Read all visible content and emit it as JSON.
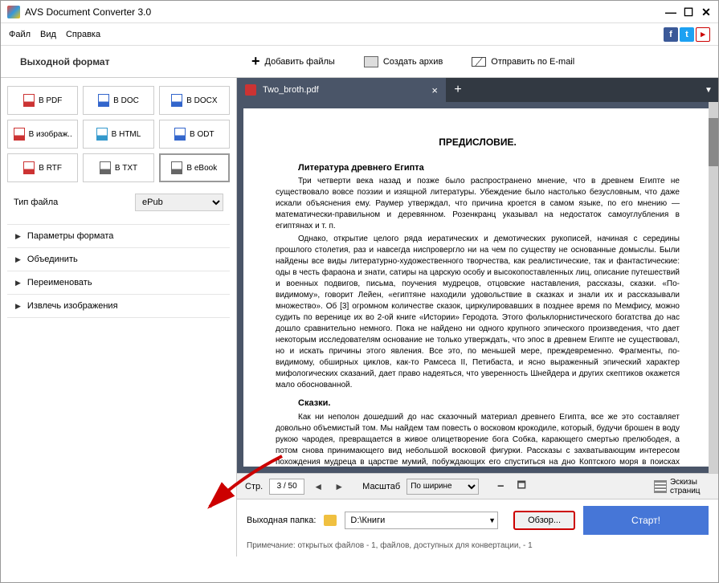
{
  "window": {
    "title": "AVS Document Converter 3.0"
  },
  "menu": {
    "file": "Файл",
    "view": "Вид",
    "help": "Справка"
  },
  "sidebar": {
    "header": "Выходной формат",
    "formats": [
      "В PDF",
      "В DOC",
      "В DOCX",
      "В изображ..",
      "В HTML",
      "В ODT",
      "В RTF",
      "В TXT",
      "В eBook"
    ],
    "filetype_label": "Тип файла",
    "filetype_value": "ePub",
    "accordion": [
      "Параметры формата",
      "Объединить",
      "Переименовать",
      "Извлечь изображения"
    ]
  },
  "toolbar": {
    "add": "Добавить файлы",
    "archive": "Создать архив",
    "email": "Отправить по E-mail"
  },
  "tab": {
    "name": "Two_broth.pdf"
  },
  "document": {
    "heading": "ПРЕДИСЛОВИЕ.",
    "sub1": "Литература древнего Египта",
    "p1": "Три четверти века назад и позже было распространено мнение, что в древнем Египте не существовало вовсе поэзии и изящной литературы. Убеждение было настолько безусловным, что даже искали объяснения ему. Раумер утверждал, что причина кроется в самом языке, по его мнению — математически-правильном и деревянном. Розенкранц указывал на недостаток самоуглубления в египтянах и т. п.",
    "p2": "Однако, открытие целого ряда иератических и демотических рукописей, начиная с середины прошлого столетия, раз и навсегда ниспровергло ни на чем по существу не основанные домыслы. Были найдены все виды литературно-художественного творчества, как реалистические, так и фантастические: оды в честь фараона и знати, сатиры на царскую особу и высокопоставленных лиц, описание путешествий и военных подвигов, письма, поучения мудрецов, отцовские наставления, рассказы, сказки. «По-видимому», говорит Лейен, «египтяне находили удовольствие в сказках и знали их и рассказывали множество». Об [3] огромном количестве сказок, циркулировавших в позднее время по Мемфису, можно судить по веренице их во 2-ой книге «Истории» Геродота. Этого фольклорнистического богатства до нас дошло сравнительно немного. Пока не найдено ни одного крупного эпического произведения, что дает некоторым исследователям основание не только утверждать, что эпос в древнем Египте не существовал, но и искать причины этого явления. Все это, по меньшей мере, преждевременно. Фрагменты, по-видимому, обширных циклов, как-то Рамсеса II, Петибаста, и ясно выраженный эпический характер мифологических сказаний, дает право надеяться, что уверенность Шнейдера и других скептиков окажется мало обоснованной.",
    "sub2": "Сказки.",
    "p3": "Как ни неполон дошедший до нас сказочный материал древнего Египта, все же это составляет довольно объемистый том. Мы найдем там повесть о восковом крокодиле, который, будучи брошен в воду рукою чародея, превращается в живое олицетворение бога Собка, карающего смертью прелюбодея, а потом снова принимающего вид небольшой восковой фигурки. Рассказы с захватывающим интересом похождения мудреца в царстве мумий, побуждающих его спуститься на дно Коптского моря в поисках волшебной книги Тота, сияющей как солнце и сообщающей сверхъестественное ведение. Одно за другим услышим лукавые надувательства гениального вора, у которого фараон, после тщетных усилий переловить воров,"
  },
  "controls": {
    "page_label": "Стр.",
    "page_value": "3 / 50",
    "zoom_label": "Масштаб",
    "zoom_value": "По ширине",
    "thumbs": "Эскизы страниц"
  },
  "bottom": {
    "output_label": "Выходная папка:",
    "path": "D:\\Книги",
    "browse": "Обзор...",
    "start": "Старт!",
    "note": "Примечание: открытых файлов - 1, файлов, доступных для конвертации, - 1"
  }
}
